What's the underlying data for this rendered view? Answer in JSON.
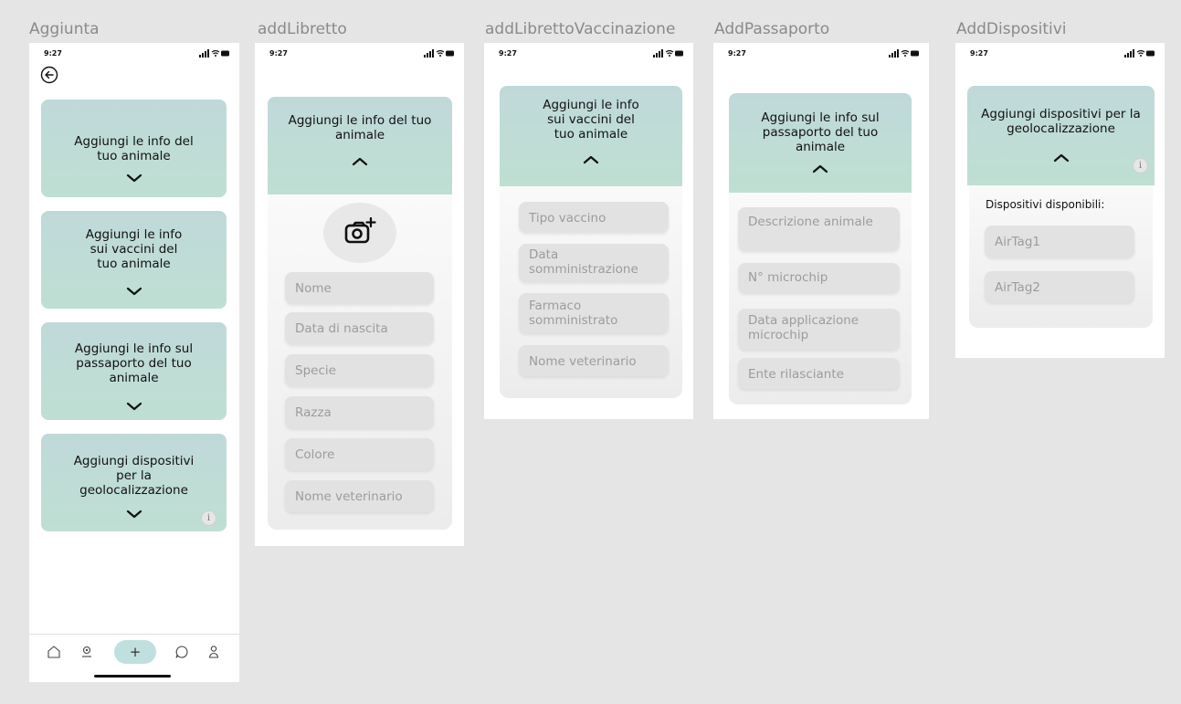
{
  "status": {
    "time": "9:27"
  },
  "frames": {
    "aggiunta": {
      "title": "Aggiunta",
      "cards": {
        "info": "Aggiungi le info del tuo animale",
        "vaccini": "Aggiungi le info sui vaccini del tuo animale",
        "passaporto": "Aggiungi le info sul passaporto del tuo animale",
        "dispositivi": "Aggiungi dispositivi per la geolocalizzazione"
      },
      "info_glyph": "i",
      "tabbar": {
        "add_label": "+"
      }
    },
    "add_libretto": {
      "title": "addLibretto",
      "header": "Aggiungi le info del tuo animale",
      "fields": [
        "Nome",
        "Data di nascita",
        "Specie",
        "Razza",
        "Colore",
        "Nome veterinario"
      ]
    },
    "add_libretto_vaccinazione": {
      "title": "addLibrettoVaccinazione",
      "header": "Aggiungi le info sui vaccini del tuo animale",
      "fields": [
        "Tipo vaccino",
        "Data somministrazione",
        "Farmaco somministrato",
        "Nome veterinario"
      ]
    },
    "add_passaporto": {
      "title": "AddPassaporto",
      "header": "Aggiungi le info sul passaporto del tuo animale",
      "fields": [
        "Descrizione animale",
        "N° microchip",
        "Data applicazione microchip",
        "Ente rilasciante"
      ]
    },
    "add_dispositivi": {
      "title": "AddDispositivi",
      "header": "Aggiungi dispositivi per la geolocalizzazione",
      "list_label": "Dispositivi disponibili:",
      "devices": [
        "AirTag1",
        "AirTag2"
      ],
      "info_glyph": "i"
    }
  },
  "colors": {
    "background": "#e5e5e5",
    "card_gradient_top": "#bfd9d9",
    "card_gradient_bottom": "#bfdfd2",
    "field": "#e2e2e2",
    "field_text": "#9c9c9c",
    "add_button": "#bfe0de"
  },
  "icons": [
    "back-arrow-icon",
    "chevron-down-icon",
    "chevron-up-icon",
    "info-icon",
    "add-photo-icon",
    "home-icon",
    "map-pin-icon",
    "chat-icon",
    "profile-icon",
    "signal-icon",
    "wifi-icon",
    "battery-icon"
  ]
}
